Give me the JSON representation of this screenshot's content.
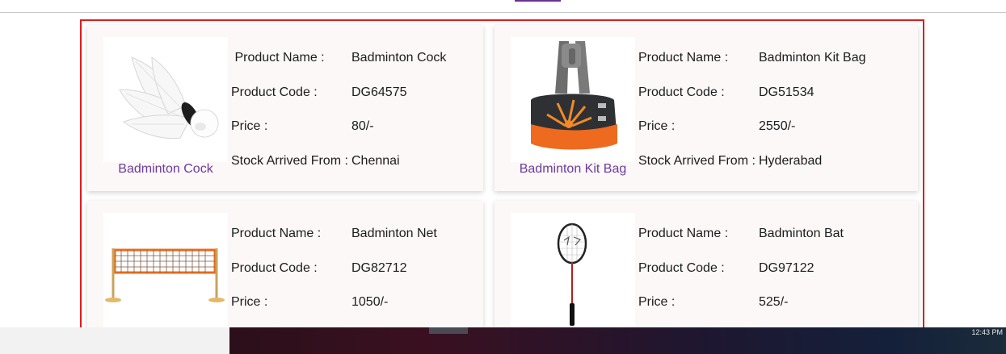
{
  "labels": {
    "name": "Product Name :",
    "name_indented": " Product Name :",
    "code": "Product Code :",
    "price": "Price :",
    "stock": "Stock Arrived From :"
  },
  "products": [
    {
      "name": "Badminton Cock",
      "code": "DG64575",
      "price": "80/-",
      "stock": "Chennai",
      "caption": "Badminton Cock",
      "image": "shuttlecock-image"
    },
    {
      "name": "Badminton Kit Bag",
      "code": "DG51534",
      "price": "2550/-",
      "stock": "Hyderabad",
      "caption": "Badminton Kit Bag",
      "image": "kit-bag-image"
    },
    {
      "name": "Badminton Net",
      "code": "DG82712",
      "price": "1050/-",
      "image": "net-image"
    },
    {
      "name": "Badminton Bat",
      "code": "DG97122",
      "price": "525/-",
      "image": "racket-image"
    }
  ],
  "taskbar": {
    "clock": "12:43 PM"
  },
  "colors": {
    "frame_border": "#e01b1b",
    "caption_link": "#6b3aa0",
    "card_bg": "#fcf8f7"
  }
}
